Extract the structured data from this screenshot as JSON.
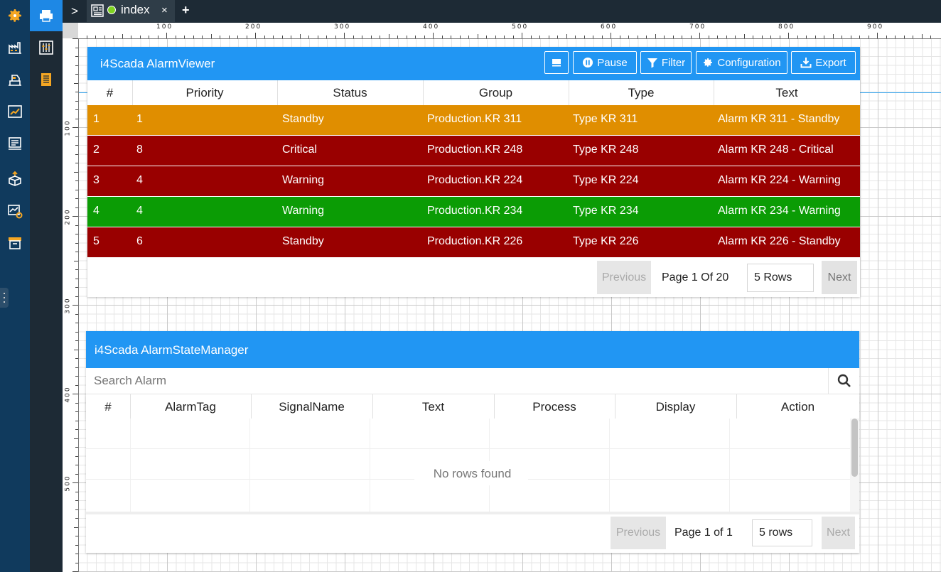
{
  "tab": {
    "label": "index",
    "close": "×",
    "add": "+"
  },
  "expand_arrow": ">",
  "ruler": {
    "top": [
      "100",
      "200",
      "300",
      "400",
      "500",
      "600",
      "700",
      "800",
      "900"
    ],
    "left": [
      "100",
      "200",
      "300",
      "400",
      "500"
    ]
  },
  "alarm_viewer": {
    "title": "i4Scada AlarmViewer",
    "buttons": {
      "pause": "Pause",
      "filter": "Filter",
      "configuration": "Configuration",
      "export": "Export"
    },
    "columns": [
      "#",
      "Priority",
      "Status",
      "Group",
      "Type",
      "Text"
    ],
    "rows": [
      {
        "num": "1",
        "priority": "1",
        "status": "Standby",
        "group": "Production.KR 311",
        "type": "Type KR 311",
        "text": "Alarm KR 311 - Standby",
        "color": "#e08e00"
      },
      {
        "num": "2",
        "priority": "8",
        "status": "Critical",
        "group": "Production.KR 248",
        "type": "Type KR 248",
        "text": "Alarm KR 248 - Critical",
        "color": "#990000"
      },
      {
        "num": "3",
        "priority": "4",
        "status": "Warning",
        "group": "Production.KR 224",
        "type": "Type KR 224",
        "text": "Alarm KR 224 - Warning",
        "color": "#990000"
      },
      {
        "num": "4",
        "priority": "4",
        "status": "Warning",
        "group": "Production.KR 234",
        "type": "Type KR 234",
        "text": "Alarm KR 234 - Warning",
        "color": "#0b9c05"
      },
      {
        "num": "5",
        "priority": "6",
        "status": "Standby",
        "group": "Production.KR 226",
        "type": "Type KR 226",
        "text": "Alarm KR 226 - Standby",
        "color": "#990000"
      }
    ],
    "pager": {
      "previous": "Previous",
      "page": "Page 1 Of 20",
      "rows": "5 Rows",
      "next": "Next"
    }
  },
  "alarm_state_manager": {
    "title": "i4Scada AlarmStateManager",
    "search_placeholder": "Search Alarm",
    "columns": [
      "#",
      "AlarmTag",
      "SignalName",
      "Text",
      "Process",
      "Display",
      "Action"
    ],
    "empty": "No rows found",
    "pager": {
      "previous": "Previous",
      "page": "Page 1 of 1",
      "rows": "5 rows",
      "next": "Next"
    }
  },
  "colors": {
    "accent": "#2196f3",
    "nav_dark": "#103a5d",
    "nav_icon": "#f5a623"
  }
}
